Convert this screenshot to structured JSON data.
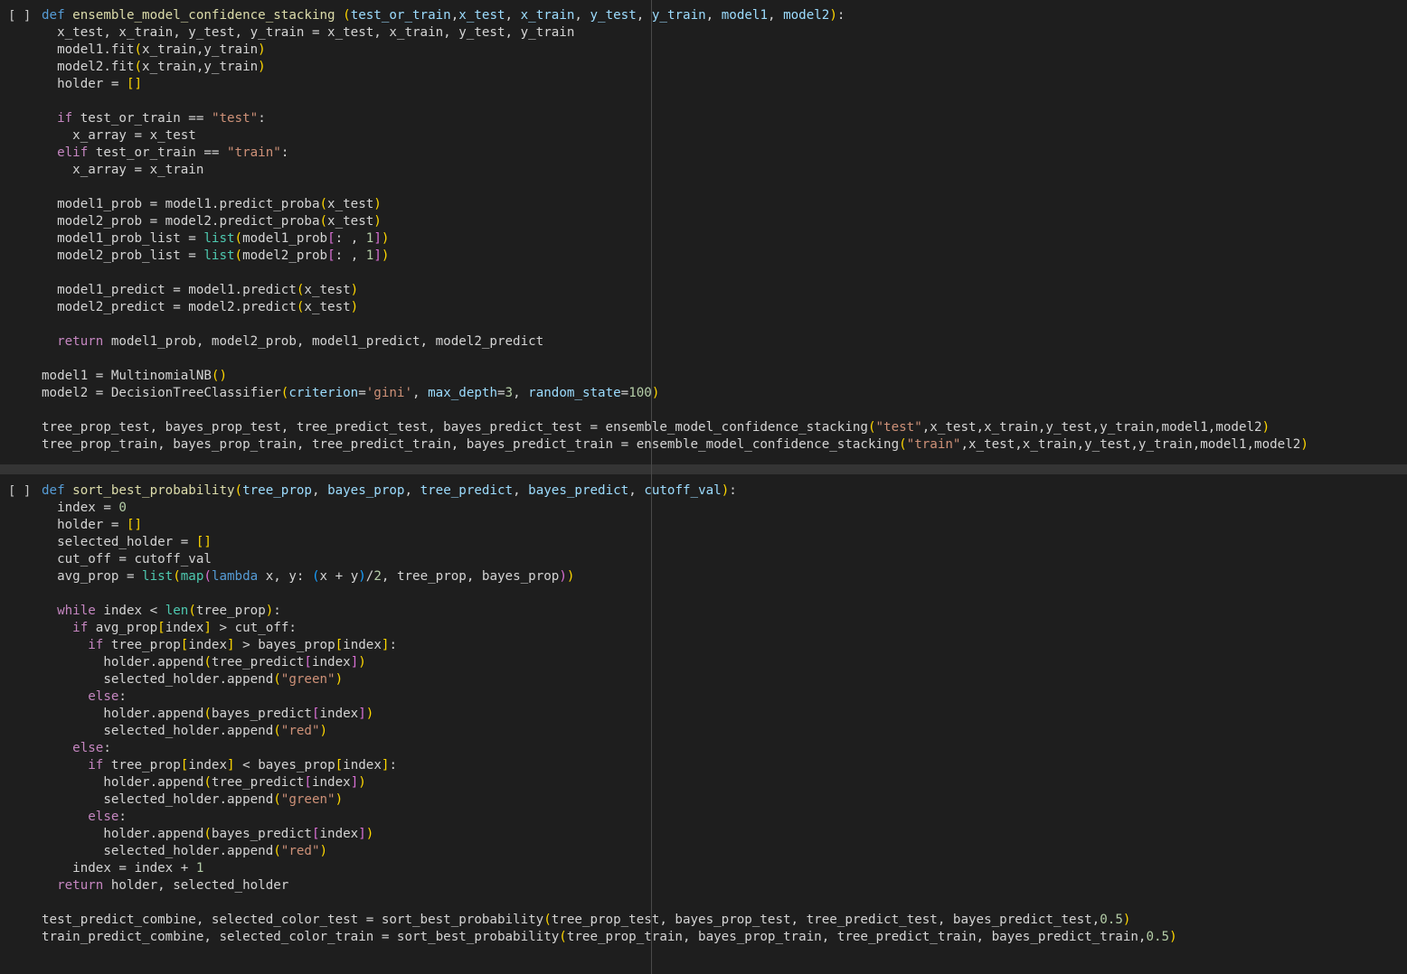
{
  "cells": [
    {
      "run_label": "[ ]",
      "lines": [
        "def ensemble_model_confidence_stacking (test_or_train,x_test, x_train, y_test, y_train, model1, model2):",
        "  x_test, x_train, y_test, y_train = x_test, x_train, y_test, y_train",
        "  model1.fit(x_train,y_train)",
        "  model2.fit(x_train,y_train)",
        "  holder = []",
        "",
        "  if test_or_train == \"test\":",
        "    x_array = x_test",
        "  elif test_or_train == \"train\":",
        "    x_array = x_train",
        "",
        "  model1_prob = model1.predict_proba(x_test)",
        "  model2_prob = model2.predict_proba(x_test)",
        "  model1_prob_list = list(model1_prob[: , 1])",
        "  model2_prob_list = list(model2_prob[: , 1])",
        "",
        "  model1_predict = model1.predict(x_test)",
        "  model2_predict = model2.predict(x_test)",
        "",
        "  return model1_prob, model2_prob, model1_predict, model2_predict",
        "",
        "model1 = MultinomialNB()",
        "model2 = DecisionTreeClassifier(criterion='gini', max_depth=3, random_state=100)",
        "",
        "tree_prop_test, bayes_prop_test, tree_predict_test, bayes_predict_test = ensemble_model_confidence_stacking(\"test\",x_test,x_train,y_test,y_train,model1,model2)",
        "tree_prop_train, bayes_prop_train, tree_predict_train, bayes_predict_train = ensemble_model_confidence_stacking(\"train\",x_test,x_train,y_test,y_train,model1,model2)"
      ]
    },
    {
      "run_label": "[ ]",
      "lines": [
        "def sort_best_probability(tree_prop, bayes_prop, tree_predict, bayes_predict, cutoff_val):",
        "  index = 0",
        "  holder = []",
        "  selected_holder = []",
        "  cut_off = cutoff_val",
        "  avg_prop = list(map(lambda x, y: (x + y)/2, tree_prop, bayes_prop))",
        "",
        "  while index < len(tree_prop):",
        "    if avg_prop[index] > cut_off:",
        "      if tree_prop[index] > bayes_prop[index]:",
        "        holder.append(tree_predict[index])",
        "        selected_holder.append(\"green\")",
        "      else:",
        "        holder.append(bayes_predict[index])",
        "        selected_holder.append(\"red\")",
        "    else:",
        "      if tree_prop[index] < bayes_prop[index]:",
        "        holder.append(tree_predict[index])",
        "        selected_holder.append(\"green\")",
        "      else:",
        "        holder.append(bayes_predict[index])",
        "        selected_holder.append(\"red\")",
        "    index = index + 1",
        "  return holder, selected_holder",
        "",
        "test_predict_combine, selected_color_test = sort_best_probability(tree_prop_test, bayes_prop_test, tree_predict_test, bayes_predict_test,0.5)",
        "train_predict_combine, selected_color_train = sort_best_probability(tree_prop_train, bayes_prop_train, tree_predict_train, bayes_predict_train,0.5)"
      ]
    }
  ],
  "colors": {
    "background": "#1e1e1e",
    "divider": "#343434",
    "ruler": "#4a4a4a",
    "keyword": "#569cd6",
    "control": "#c586c0",
    "function": "#dcdcaa",
    "parameter": "#9cdcfe",
    "string": "#ce9178",
    "number": "#b5cea8",
    "builtin": "#4ec9b0",
    "bracket": "#ffd700"
  }
}
